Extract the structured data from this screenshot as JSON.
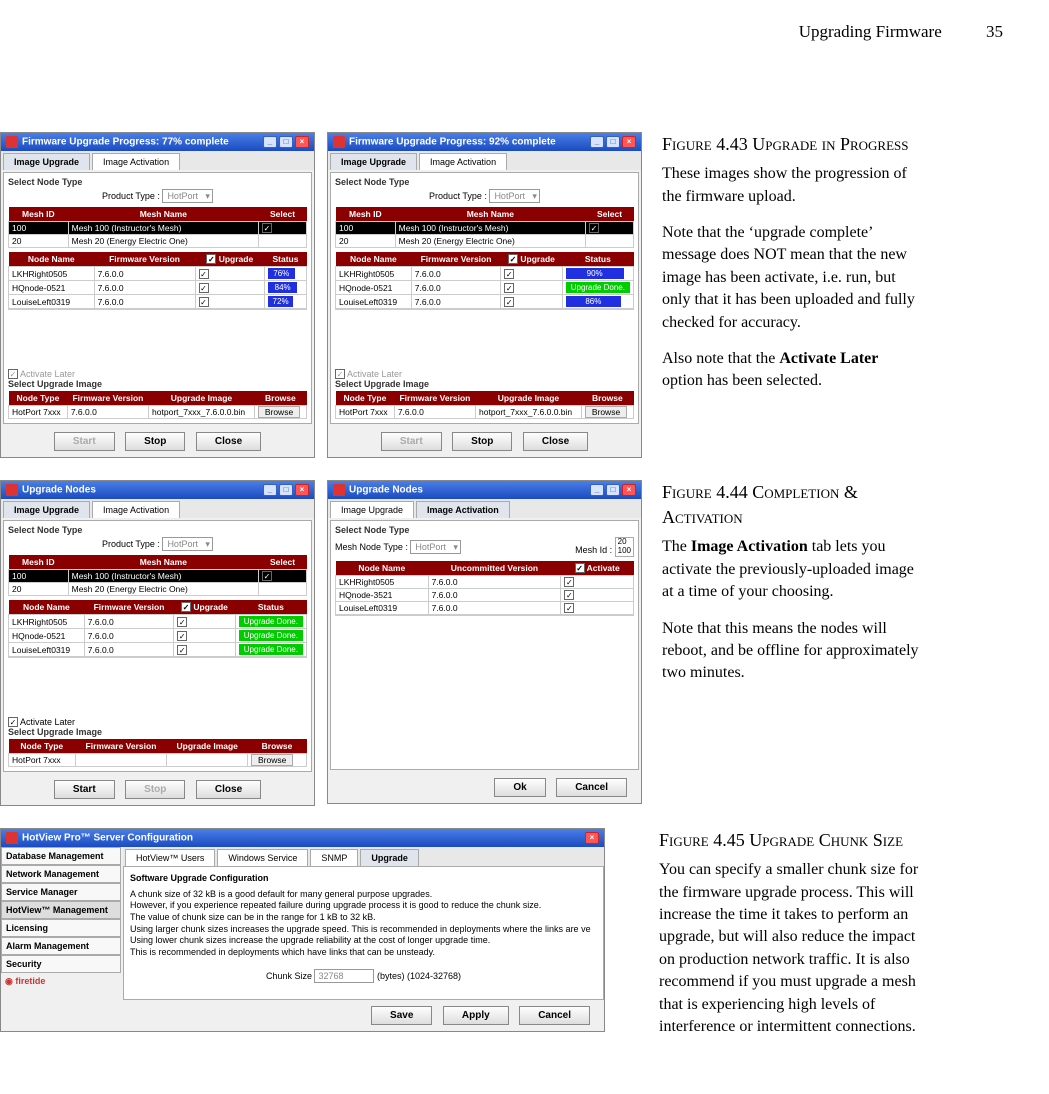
{
  "header": {
    "section": "Upgrading Firmware",
    "page": "35"
  },
  "common": {
    "selectNodeType": "Select Node Type",
    "productType": "Product Type :",
    "hotport": "HotPort",
    "activateLater": "Activate Later",
    "selectUpgradeImage": "Select Upgrade Image",
    "browse": "Browse",
    "start": "Start",
    "stop": "Stop",
    "close": "Close",
    "ok": "Ok",
    "cancel": "Cancel",
    "save": "Save",
    "apply": "Apply",
    "imageUpgrade": "Image Upgrade",
    "imageActivation": "Image Activation"
  },
  "fig43": {
    "title": "Figure 4.43 Upgrade in Progress",
    "desc1": "These images show the progression of the firmware upload.",
    "desc2": "Note that the ‘upgrade complete’ message does NOT mean that the new image has been activate, i.e. run, but only that it has been uploaded and fully checked for accuracy.",
    "desc3_a": "Also note that the ",
    "desc3_b": "Activate Later",
    "desc3_c": " option has been selected.",
    "dlgA": {
      "title": "Firmware Upgrade Progress: 77% complete",
      "meshCols": [
        "Mesh ID",
        "Mesh Name",
        "Select"
      ],
      "meshRows": [
        {
          "id": "100",
          "name": "Mesh 100 (Instructor's Mesh)",
          "sel": true
        },
        {
          "id": "20",
          "name": "Mesh 20 (Energy Electric One)",
          "sel": false
        }
      ],
      "nodeCols": [
        "Node Name",
        "Firmware Version",
        "Upgrade",
        "Status"
      ],
      "nodeRows": [
        {
          "name": "LKHRight0505",
          "ver": "7.6.0.0",
          "pct": "76%"
        },
        {
          "name": "HQnode-0521",
          "ver": "7.6.0.0",
          "pct": "84%"
        },
        {
          "name": "LouiseLeft0319",
          "ver": "7.6.0.0",
          "pct": "72%"
        }
      ],
      "imgCols": [
        "Node Type",
        "Firmware Version",
        "Upgrade Image",
        "Browse"
      ],
      "imgRow": {
        "type": "HotPort 7xxx",
        "ver": "7.6.0.0",
        "img": "hotport_7xxx_7.6.0.0.bin"
      }
    },
    "dlgB": {
      "title": "Firmware Upgrade Progress: 92% complete",
      "nodeRows": [
        {
          "name": "LKHRight0505",
          "ver": "7.6.0.0",
          "pct": "90%",
          "style": "bar"
        },
        {
          "name": "HQnode-0521",
          "ver": "7.6.0.0",
          "pct": "Upgrade Done.",
          "style": "done"
        },
        {
          "name": "LouiseLeft0319",
          "ver": "7.6.0.0",
          "pct": "86%",
          "style": "bar"
        }
      ]
    }
  },
  "fig44": {
    "title": "Figure 4.44 Completion & Activation",
    "desc1_a": "The ",
    "desc1_b": "Image Activation",
    "desc1_c": " tab lets you activate the previously-uploaded image at a time of your choosing.",
    "desc2": "Note that this means the nodes will reboot, and be offline for approximately two minutes.",
    "dlgA": {
      "title": "Upgrade Nodes",
      "nodeRows": [
        {
          "name": "LKHRight0505",
          "ver": "7.6.0.0"
        },
        {
          "name": "HQnode-0521",
          "ver": "7.6.0.0"
        },
        {
          "name": "LouiseLeft0319",
          "ver": "7.6.0.0"
        }
      ]
    },
    "dlgB": {
      "title": "Upgrade Nodes",
      "meshNodeType": "Mesh Node Type :",
      "meshIdLabel": "Mesh Id :",
      "meshIds": [
        "20",
        "100"
      ],
      "cols": [
        "Node Name",
        "Uncommitted Version",
        "Activate"
      ],
      "rows": [
        {
          "name": "LKHRight0505",
          "ver": "7.6.0.0"
        },
        {
          "name": "HQnode-3521",
          "ver": "7.6.0.0"
        },
        {
          "name": "LouiseLeft0319",
          "ver": "7.6.0.0"
        }
      ]
    }
  },
  "fig45": {
    "title": "Figure 4.45 Upgrade Chunk Size",
    "desc": "You can specify a smaller chunk size for the firmware upgrade process. This will increase the time it takes to perform an upgrade, but will also reduce the impact on production network traffic. It is also recommend if you must upgrade a mesh that is experiencing high levels of interference or intermittent connections.",
    "dlg": {
      "title": "HotView Pro™ Server Configuration",
      "side": [
        "Database Management",
        "Network Management",
        "Service Manager",
        "HotView™ Management",
        "Licensing",
        "Alarm Management",
        "Security"
      ],
      "tabs": [
        "HotView™ Users",
        "Windows Service",
        "SNMP",
        "Upgrade"
      ],
      "sectionTitle": "Software Upgrade Configuration",
      "line1": "A chunk size of 32 kB is a good default for many general purpose upgrades.",
      "line2": "However, if you experience repeated failure during upgrade process it is good to reduce the chunk size.",
      "line3": "The value of chunk size can be in the range for 1 kB to 32 kB.",
      "line4": "Using larger chunk sizes increases the upgrade speed. This is recommended in deployments where the links are ve",
      "line5": "Using lower chunk sizes increase the upgrade reliability at the cost of longer upgrade time.",
      "line6": "This is recommended in deployments which have links that can be unsteady.",
      "chunkLabel": "Chunk Size",
      "chunkVal": "32768",
      "chunkUnits": "(bytes) (1024-32768)",
      "logo": "firetide"
    }
  }
}
